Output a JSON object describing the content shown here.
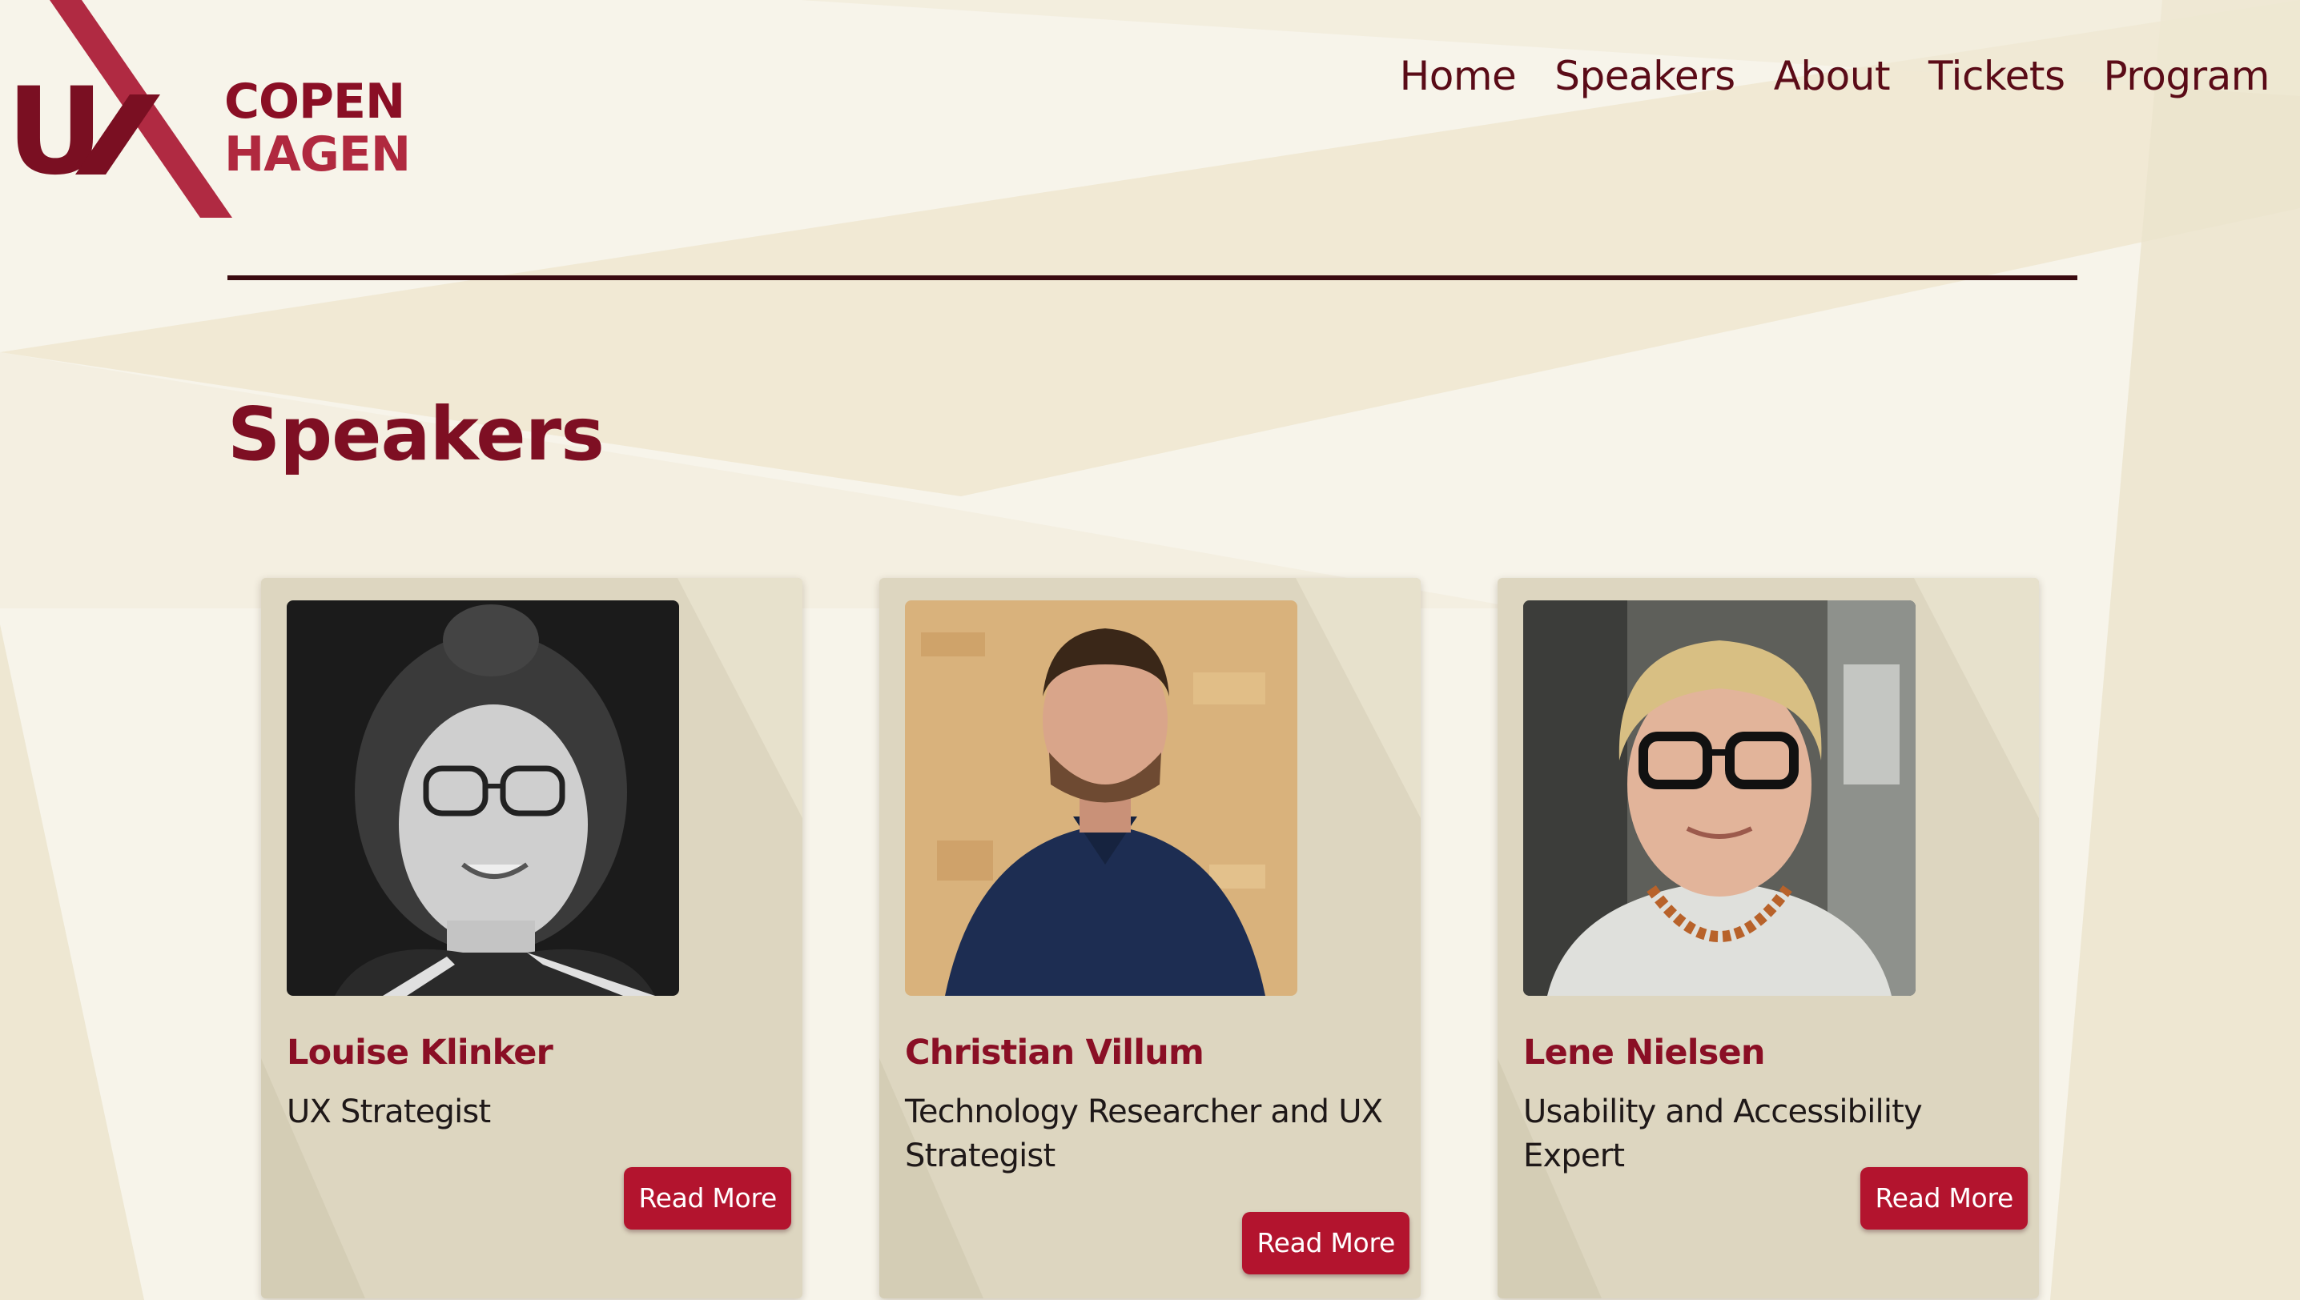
{
  "brand": {
    "logo_letter": "U",
    "logo_line1": "COPEN",
    "logo_line2": "HAGEN",
    "primary_color": "#7e0f23",
    "accent_color": "#b3142e"
  },
  "nav": {
    "items": [
      {
        "label": "Home"
      },
      {
        "label": "Speakers"
      },
      {
        "label": "About"
      },
      {
        "label": "Tickets"
      },
      {
        "label": "Program"
      }
    ]
  },
  "page": {
    "title": "Speakers"
  },
  "speakers": [
    {
      "name": "Louise Klinker",
      "role": "UX Strategist",
      "button": "Read More"
    },
    {
      "name": "Christian Villum",
      "role": "Technology Researcher and UX Strategist",
      "button": "Read More"
    },
    {
      "name": "Lene Nielsen",
      "role": "Usability and Accessibility Expert",
      "button": "Read More"
    }
  ]
}
